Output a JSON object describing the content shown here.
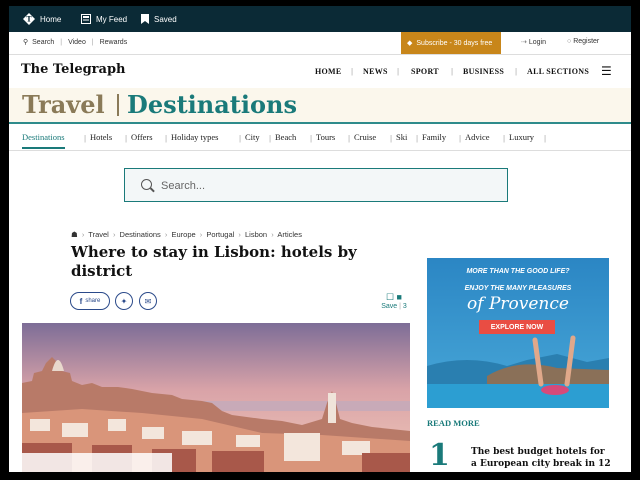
{
  "topbar": {
    "items": [
      {
        "label": "Home",
        "icon": "telegraph-t-icon"
      },
      {
        "label": "My Feed",
        "icon": "feed-icon"
      },
      {
        "label": "Saved",
        "icon": "bookmark-icon"
      }
    ]
  },
  "utilbar": {
    "search": "Search",
    "video": "Video",
    "rewards": "Rewards",
    "subscribe": "Subscribe - 30 days free",
    "login": "Login",
    "register": "Register"
  },
  "masthead": {
    "logo": "The Telegraph",
    "nav": [
      "HOME",
      "NEWS",
      "SPORT",
      "BUSINESS",
      "ALL SECTIONS"
    ]
  },
  "hero": {
    "section": "Travel",
    "subsection": "Destinations"
  },
  "subnav": [
    "Destinations",
    "Hotels",
    "Offers",
    "Holiday types",
    "City",
    "Beach",
    "Tours",
    "Cruise",
    "Ski",
    "Family",
    "Advice",
    "Luxury"
  ],
  "search": {
    "placeholder": "Search..."
  },
  "breadcrumb": [
    "Travel",
    "Destinations",
    "Europe",
    "Portugal",
    "Lisbon",
    "Articles"
  ],
  "article": {
    "headline": "Where to stay in Lisbon: hotels by district",
    "share_label": "share",
    "save_label": "Save",
    "comment_count": "3"
  },
  "ad": {
    "line1": "MORE THAN THE GOOD LIFE?",
    "line2": "ENJOY THE MANY PLEASURES",
    "line3": "of Provence",
    "cta": "EXPLORE NOW"
  },
  "read_more": {
    "heading": "READ MORE",
    "items": [
      {
        "number": "1",
        "title": "The best budget hotels for a European city break in 12"
      }
    ]
  },
  "colors": {
    "accent": "#1a7a7a",
    "topbar": "#0b2a36",
    "subscribe": "#c8861a"
  }
}
